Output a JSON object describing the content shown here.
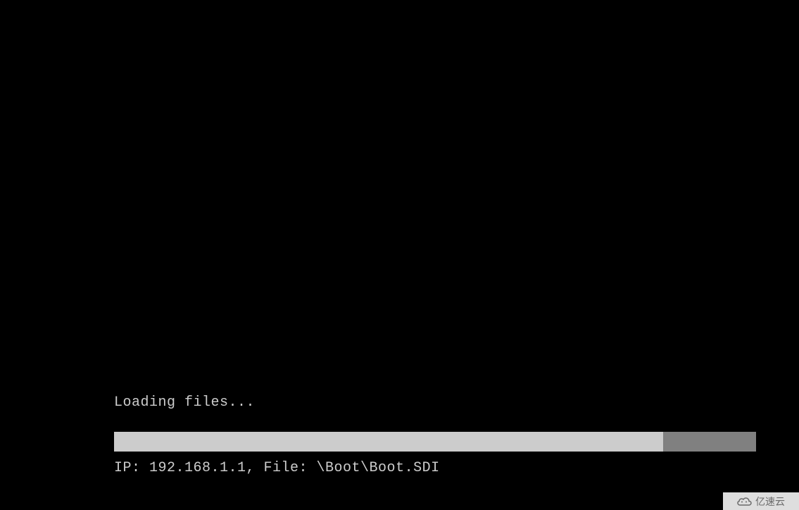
{
  "boot": {
    "loading_label": "Loading files...",
    "progress_percent": 85.5,
    "status_prefix_ip": "IP: ",
    "ip_address": "192.168.1.1",
    "status_separator": ", ",
    "status_prefix_file": "File: ",
    "file_path": "\\Boot\\Boot.SDI",
    "status_full": "IP: 192.168.1.1, File: \\Boot\\Boot.SDI",
    "colors": {
      "background": "#000000",
      "text": "#cccccc",
      "progress_bg": "#808080",
      "progress_fill": "#cccccc"
    }
  },
  "watermark": {
    "text": "亿速云"
  }
}
